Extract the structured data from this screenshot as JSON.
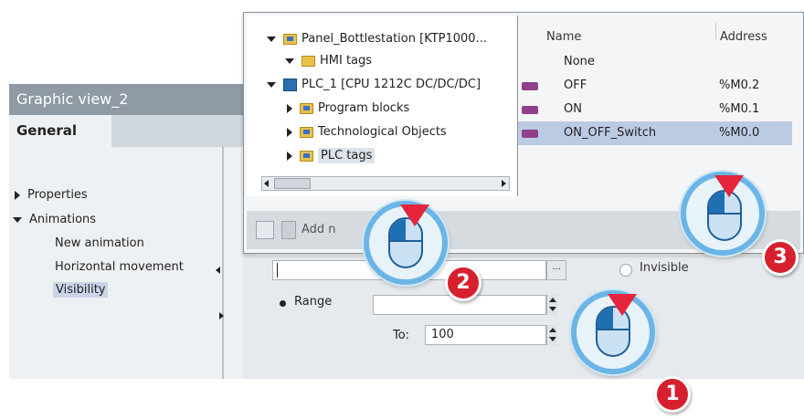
{
  "inspector": {
    "title": "Graphic view_2",
    "tab_general": "General",
    "tree": [
      {
        "label": "Properties",
        "expanded": false
      },
      {
        "label": "Animations",
        "expanded": true
      }
    ],
    "animations": [
      "New animation",
      "Horizontal movement",
      "Visibility"
    ],
    "selected": "Visibility"
  },
  "popup": {
    "tree": [
      {
        "label": "Panel_Bottlestation [KTP1000...",
        "level": 0,
        "expanded": true,
        "icon": "hmi-device-folder-icon"
      },
      {
        "label": "HMI tags",
        "level": 1,
        "expanded": true,
        "icon": "hmi-tags-folder-icon"
      },
      {
        "label": "PLC_1 [CPU 1212C DC/DC/DC]",
        "level": 0,
        "expanded": true,
        "icon": "plc-icon"
      },
      {
        "label": "Program blocks",
        "level": 1,
        "expanded": false,
        "icon": "program-blocks-folder-icon"
      },
      {
        "label": "Technological Objects",
        "level": 1,
        "expanded": false,
        "icon": "technological-objects-folder-icon"
      },
      {
        "label": "PLC tags",
        "level": 1,
        "expanded": false,
        "icon": "plc-tags-folder-icon",
        "selected": true
      }
    ],
    "table": {
      "columns": [
        "Name",
        "Address"
      ],
      "rows": [
        {
          "name": "None",
          "address": "",
          "has_icon": false
        },
        {
          "name": "OFF",
          "address": "%M0.2",
          "has_icon": true
        },
        {
          "name": "ON",
          "address": "%M0.1",
          "has_icon": true
        },
        {
          "name": "ON_OFF_Switch",
          "address": "%M0.0",
          "has_icon": true,
          "selected": true
        }
      ]
    },
    "toolbar": {
      "add_label": "Add n"
    }
  },
  "properties": {
    "tag_field_value": "",
    "browse_label": "...",
    "invisible_label": "Invisible",
    "range_label": "Range",
    "to_label": "To:",
    "to_value": "100"
  },
  "callouts": [
    {
      "number": "1"
    },
    {
      "number": "2"
    },
    {
      "number": "3"
    }
  ],
  "colors": {
    "callout_ring": "#6ab5e6",
    "badge_red": "#d7202e",
    "selection_blue": "#bccbe4"
  }
}
